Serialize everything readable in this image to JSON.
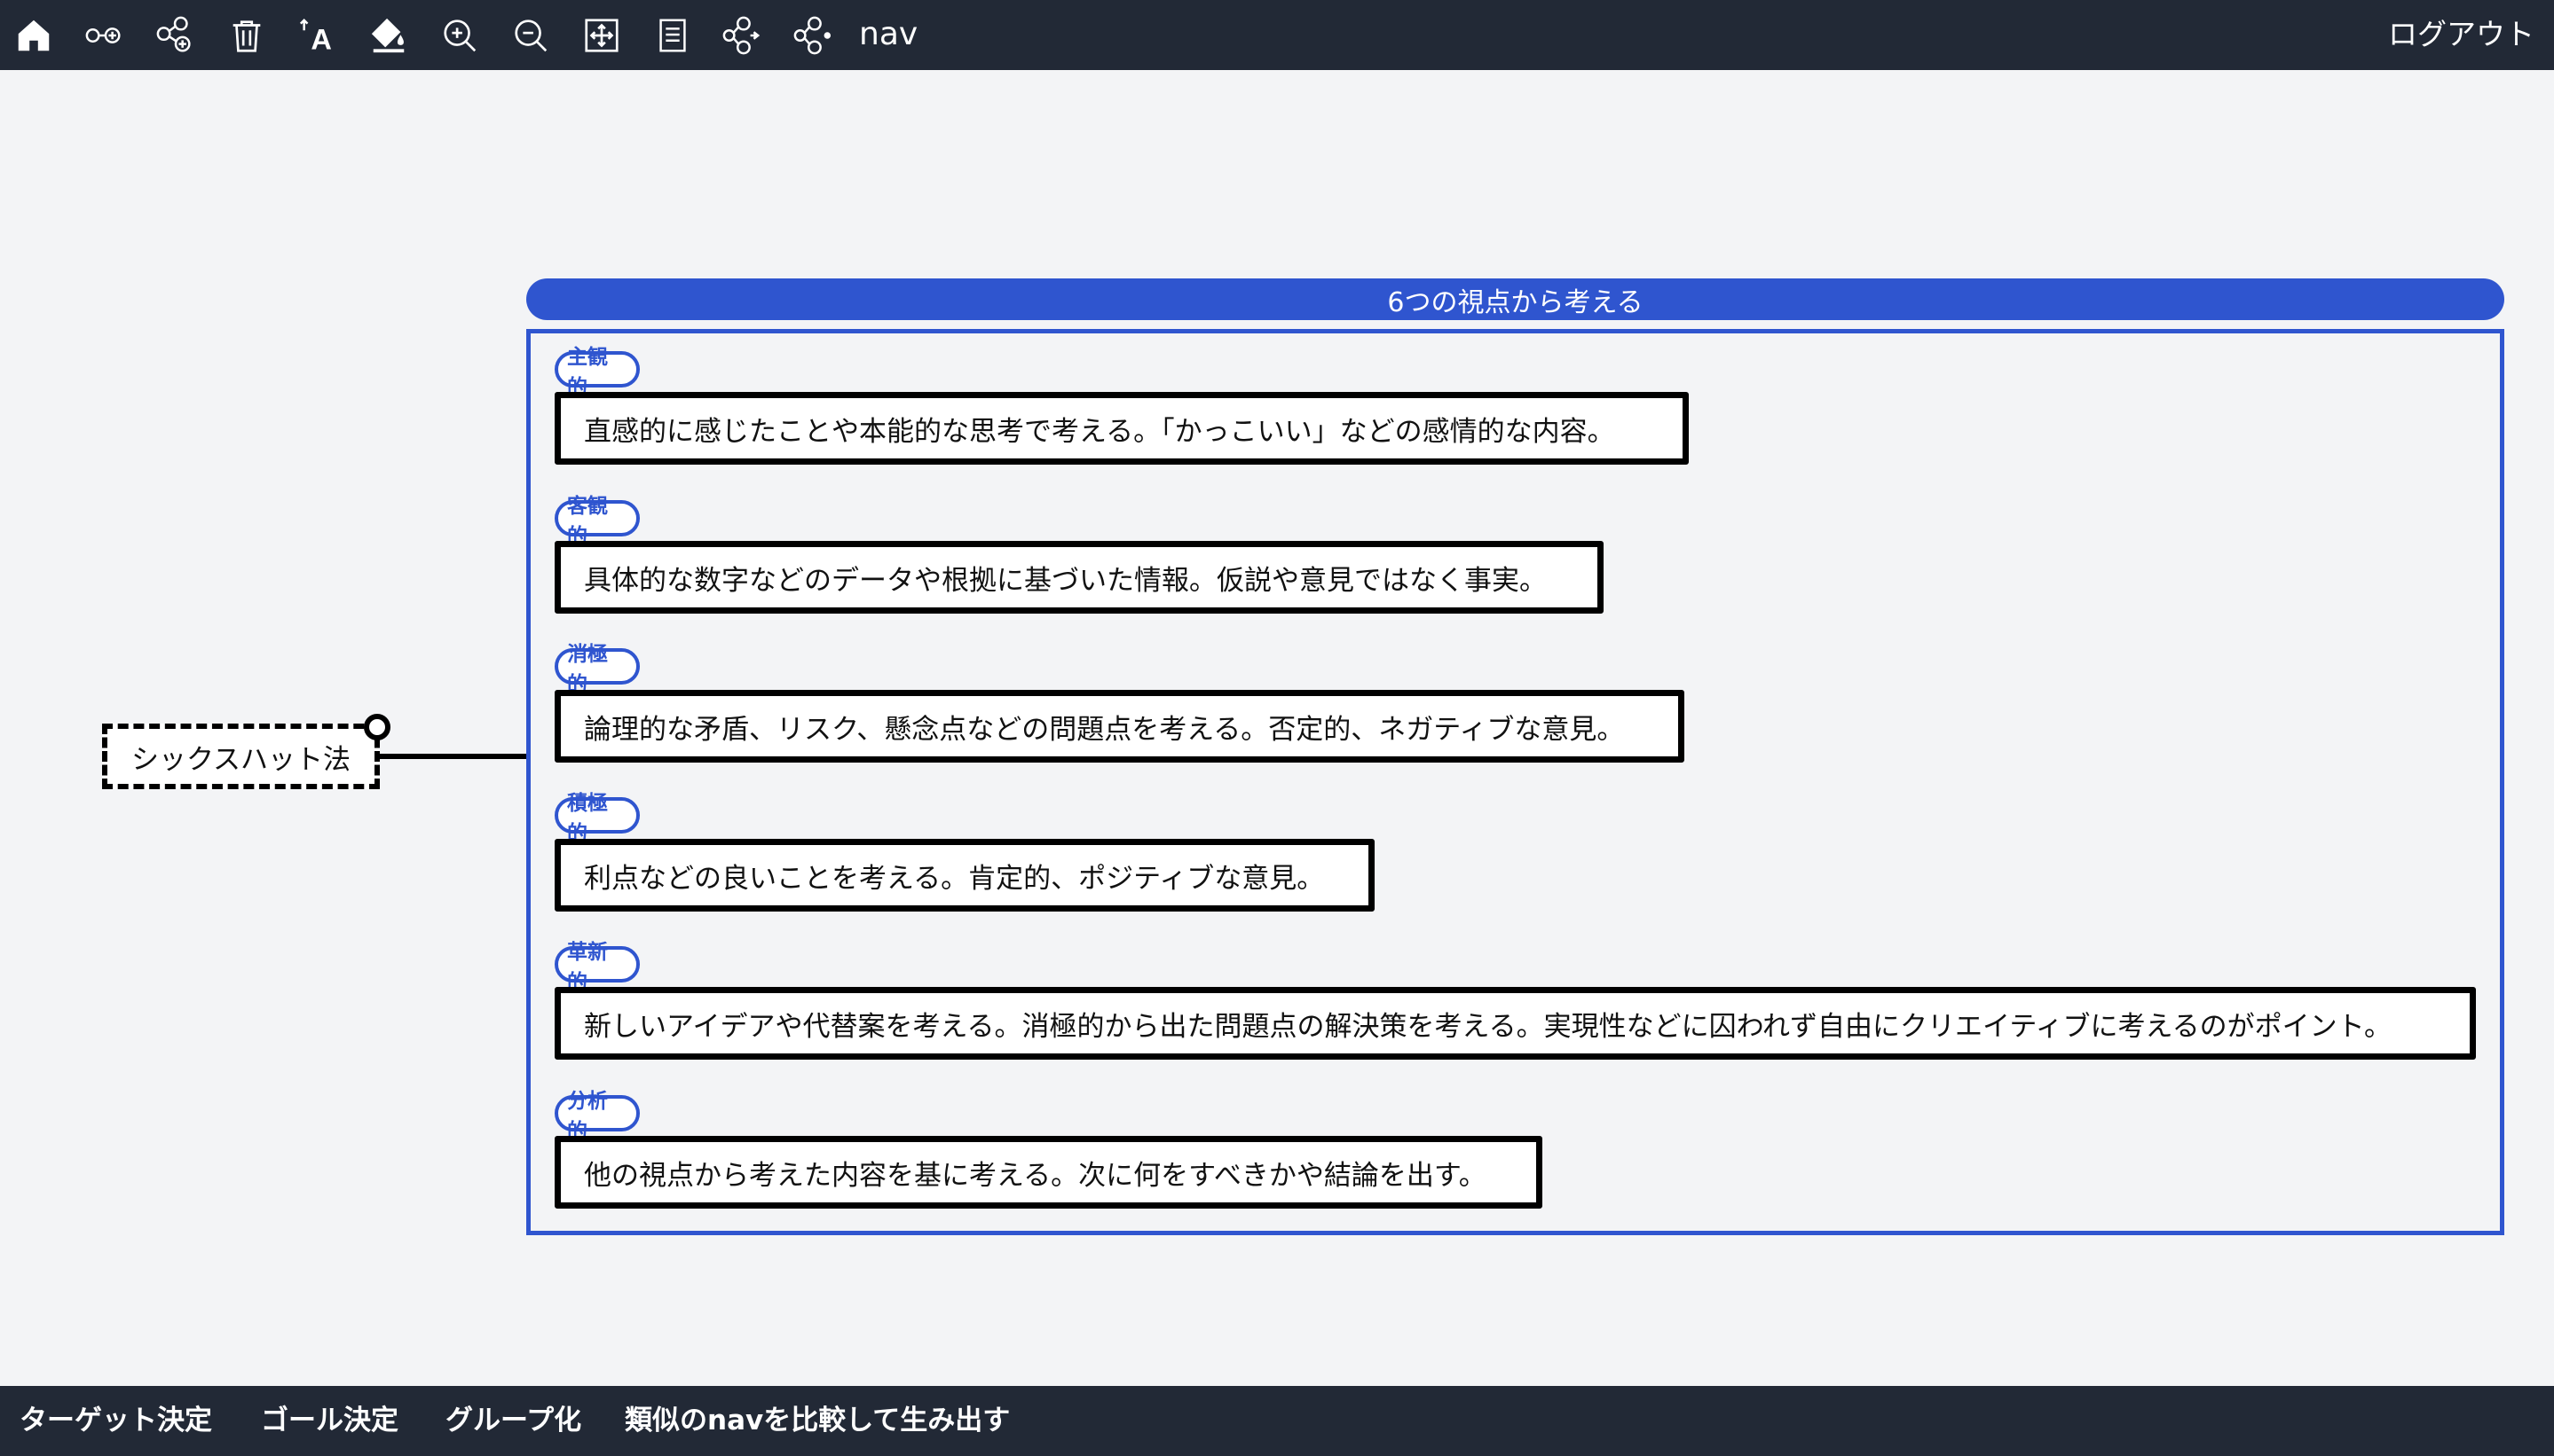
{
  "toolbar": {
    "app_name": "nav",
    "logout_label": "ログアウト"
  },
  "mindmap": {
    "root_label": "シックスハット法",
    "group_title": "6つの視点から考える",
    "items": [
      {
        "tag": "主観的",
        "text": "直感的に感じたことや本能的な思考で考える。「かっこいい」などの感情的な内容。"
      },
      {
        "tag": "客観的",
        "text": "具体的な数字などのデータや根拠に基づいた情報。仮説や意見ではなく事実。"
      },
      {
        "tag": "消極的",
        "text": "論理的な矛盾、リスク、懸念点などの問題点を考える。否定的、ネガティブな意見。"
      },
      {
        "tag": "積極的",
        "text": "利点などの良いことを考える。肯定的、ポジティブな意見。"
      },
      {
        "tag": "革新的",
        "text": "新しいアイデアや代替案を考える。消極的から出た問題点の解決策を考える。実現性などに囚われず自由にクリエイティブに考えるのがポイント。"
      },
      {
        "tag": "分析的",
        "text": "他の視点から考えた内容を基に考える。次に何をすべきかや結論を出す。"
      }
    ]
  },
  "bottom_bar": {
    "items": [
      "ターゲット決定",
      "ゴール決定",
      "グループ化",
      "類似のnavを比較して生み出す"
    ]
  },
  "colors": {
    "bar_bg": "#222936",
    "canvas_bg": "#f3f4f6",
    "accent": "#2f55cf"
  },
  "icons": [
    "home-icon",
    "add-sibling-node-icon",
    "add-child-node-icon",
    "trash-icon",
    "text-format-icon",
    "fill-color-icon",
    "zoom-in-icon",
    "zoom-out-icon",
    "fit-view-icon",
    "document-icon",
    "expand-right-icon",
    "expand-left-icon"
  ]
}
